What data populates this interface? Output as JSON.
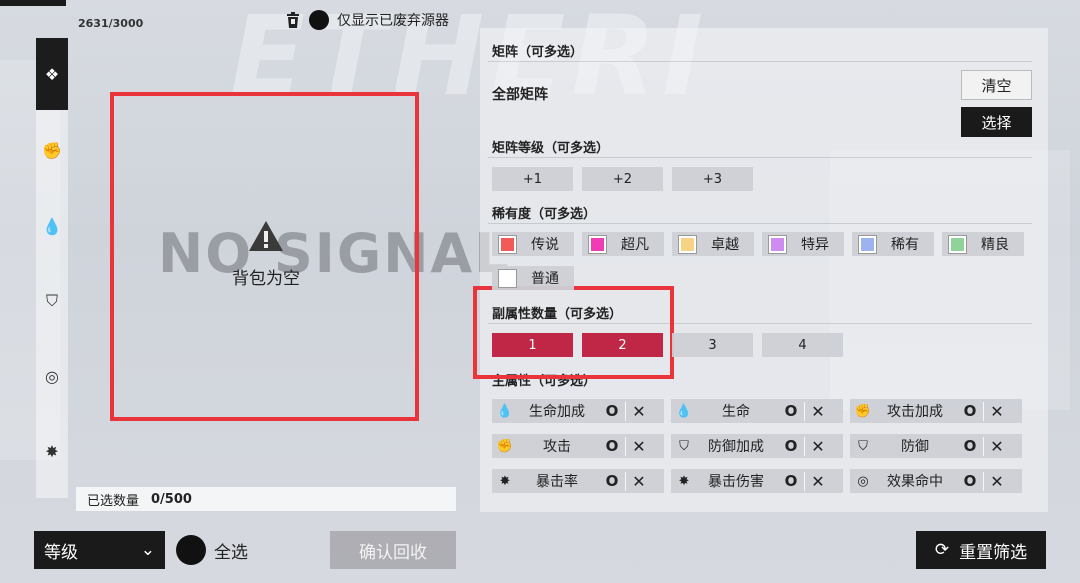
{
  "inventory": {
    "count": "2631/3000",
    "discard_label": "仅显示已废弃源器",
    "no_signal": "NO SIGNAL",
    "empty_text": "背包为空",
    "selected_label": "已选数量",
    "selected_value": "0/500"
  },
  "rail": {
    "items": [
      "all-icon",
      "fist-icon",
      "drop-icon",
      "shield-icon",
      "target-icon",
      "burst-icon"
    ]
  },
  "bottom": {
    "sort_value": "等级",
    "select_all": "全选",
    "confirm": "确认回收",
    "reset": "重置筛选"
  },
  "filters": {
    "matrix_title": "矩阵（可多选）",
    "matrix_all": "全部矩阵",
    "clear": "清空",
    "choose": "选择",
    "matrix_level_title": "矩阵等级（可多选）",
    "matrix_levels": [
      "+1",
      "+2",
      "+3"
    ],
    "rarity_title": "稀有度（可多选）",
    "rarities": [
      {
        "label": "传说",
        "color": "#f25a5a"
      },
      {
        "label": "超凡",
        "color": "#f03cb5"
      },
      {
        "label": "卓越",
        "color": "#f6d385"
      },
      {
        "label": "特异",
        "color": "#cf8cf0"
      },
      {
        "label": "稀有",
        "color": "#9cb3f0"
      },
      {
        "label": "精良",
        "color": "#8fd39a"
      },
      {
        "label": "普通",
        "color": "#ffffff"
      }
    ],
    "sub_count_title": "副属性数量（可多选）",
    "sub_counts": [
      "1",
      "2",
      "3",
      "4"
    ],
    "sub_counts_selected": [
      "1",
      "2"
    ],
    "main_attr_title": "主属性（可多选）",
    "attributes": [
      {
        "label": "生命加成",
        "icon": "drop-icon"
      },
      {
        "label": "生命",
        "icon": "drop-icon"
      },
      {
        "label": "攻击加成",
        "icon": "fist-icon"
      },
      {
        "label": "攻击",
        "icon": "fist-icon"
      },
      {
        "label": "防御加成",
        "icon": "shield-icon"
      },
      {
        "label": "防御",
        "icon": "shield-icon"
      },
      {
        "label": "暴击率",
        "icon": "burst-icon"
      },
      {
        "label": "暴击伤害",
        "icon": "burst-icon"
      },
      {
        "label": "效果命中",
        "icon": "target-icon"
      }
    ],
    "include_symbol": "O",
    "exclude_symbol": "✕"
  }
}
